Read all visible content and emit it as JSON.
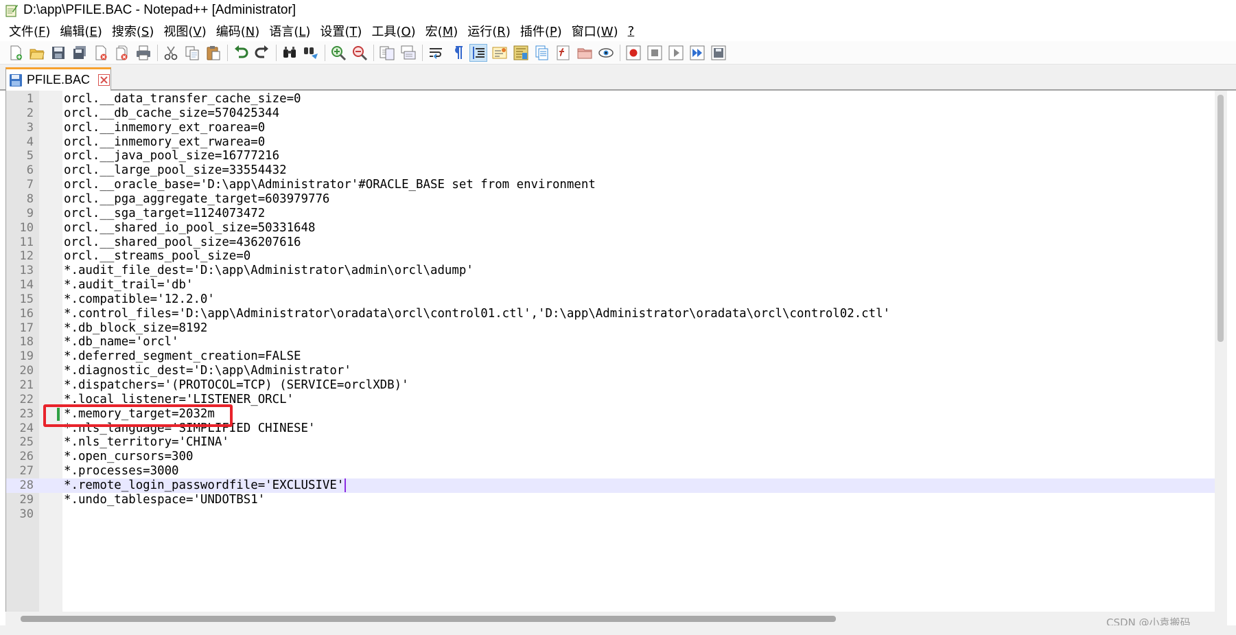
{
  "window": {
    "title": "D:\\app\\PFILE.BAC - Notepad++ [Administrator]"
  },
  "menu": [
    {
      "pre": "文件(",
      "key": "F",
      "post": ")"
    },
    {
      "pre": "编辑(",
      "key": "E",
      "post": ")"
    },
    {
      "pre": "搜索(",
      "key": "S",
      "post": ")"
    },
    {
      "pre": "视图(",
      "key": "V",
      "post": ")"
    },
    {
      "pre": "编码(",
      "key": "N",
      "post": ")"
    },
    {
      "pre": "语言(",
      "key": "L",
      "post": ")"
    },
    {
      "pre": "设置(",
      "key": "T",
      "post": ")"
    },
    {
      "pre": "工具(",
      "key": "O",
      "post": ")"
    },
    {
      "pre": "宏(",
      "key": "M",
      "post": ")"
    },
    {
      "pre": "运行(",
      "key": "R",
      "post": ")"
    },
    {
      "pre": "插件(",
      "key": "P",
      "post": ")"
    },
    {
      "pre": "窗口(",
      "key": "W",
      "post": ")"
    },
    {
      "pre": "",
      "key": "?",
      "post": ""
    }
  ],
  "toolbar": [
    [
      "new-file-icon",
      "open-file-icon",
      "save-icon",
      "save-all-icon",
      "close-icon",
      "close-all-icon",
      "print-icon"
    ],
    [
      "cut-icon",
      "copy-icon",
      "paste-icon"
    ],
    [
      "undo-icon",
      "redo-icon"
    ],
    [
      "find-icon",
      "replace-icon"
    ],
    [
      "zoom-in-icon",
      "zoom-out-icon"
    ],
    [
      "sync-vertical-icon",
      "sync-horizontal-icon"
    ],
    [
      "word-wrap-icon",
      "show-all-chars-icon",
      "indent-guide-icon",
      "user-language-icon",
      "document-map-icon",
      "doc-list-icon",
      "function-list-icon",
      "folder-workspace-icon",
      "monitoring-icon"
    ],
    [
      "record-macro-icon",
      "stop-record-icon",
      "play-macro-icon",
      "run-macro-multiple-icon",
      "save-macro-icon"
    ]
  ],
  "colors": {
    "accent_tab": "#f7a12e",
    "highlight_box": "#e8232b",
    "change_mark": "#2ea043",
    "current_line": "#e8e8ff",
    "caret": "#8a2be2"
  },
  "tab": {
    "label": "PFILE.BAC"
  },
  "editor": {
    "current_line": 28,
    "changed_line": 23,
    "highlighted_line": 23,
    "lines": [
      "orcl.__data_transfer_cache_size=0",
      "orcl.__db_cache_size=570425344",
      "orcl.__inmemory_ext_roarea=0",
      "orcl.__inmemory_ext_rwarea=0",
      "orcl.__java_pool_size=16777216",
      "orcl.__large_pool_size=33554432",
      "orcl.__oracle_base='D:\\app\\Administrator'#ORACLE_BASE set from environment",
      "orcl.__pga_aggregate_target=603979776",
      "orcl.__sga_target=1124073472",
      "orcl.__shared_io_pool_size=50331648",
      "orcl.__shared_pool_size=436207616",
      "orcl.__streams_pool_size=0",
      "*.audit_file_dest='D:\\app\\Administrator\\admin\\orcl\\adump'",
      "*.audit_trail='db'",
      "*.compatible='12.2.0'",
      "*.control_files='D:\\app\\Administrator\\oradata\\orcl\\control01.ctl','D:\\app\\Administrator\\oradata\\orcl\\control02.ctl'",
      "*.db_block_size=8192",
      "*.db_name='orcl'",
      "*.deferred_segment_creation=FALSE",
      "*.diagnostic_dest='D:\\app\\Administrator'",
      "*.dispatchers='(PROTOCOL=TCP) (SERVICE=orclXDB)'",
      "*.local_listener='LISTENER_ORCL'",
      "*.memory_target=2032m",
      "*.nls_language='SIMPLIFIED CHINESE'",
      "*.nls_territory='CHINA'",
      "*.open_cursors=300",
      "*.processes=3000",
      "*.remote_login_passwordfile='EXCLUSIVE'",
      "*.undo_tablespace='UNDOTBS1'",
      ""
    ]
  },
  "watermark": "CSDN @小袁搬码"
}
